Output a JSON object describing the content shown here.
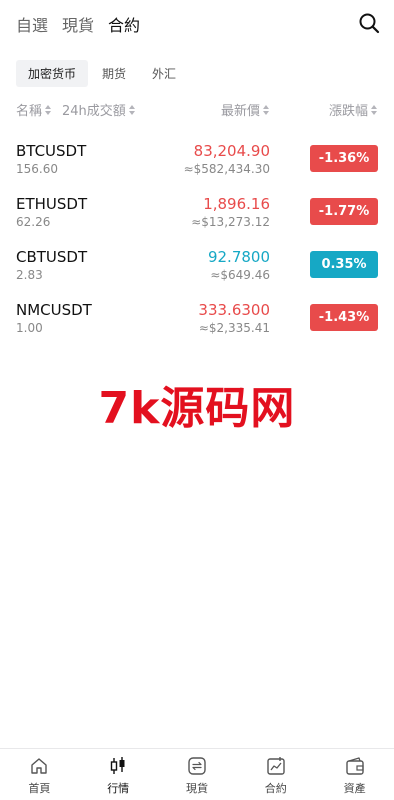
{
  "top_tabs": [
    {
      "label": "自選",
      "active": false
    },
    {
      "label": "現貨",
      "active": false
    },
    {
      "label": "合約",
      "active": true
    }
  ],
  "search_icon": "search-icon",
  "sub_tabs": [
    {
      "label": "加密货币",
      "active": true
    },
    {
      "label": "期货",
      "active": false
    },
    {
      "label": "外汇",
      "active": false
    }
  ],
  "columns": {
    "name": "名稱",
    "volume": "24h成交額",
    "price": "最新價",
    "change": "漲跌幅"
  },
  "rows": [
    {
      "symbol": "BTCUSDT",
      "volume": "156.60",
      "price": "83,204.90",
      "converted": "≈$582,434.30",
      "change": "-1.36%",
      "direction": "down"
    },
    {
      "symbol": "ETHUSDT",
      "volume": "62.26",
      "price": "1,896.16",
      "converted": "≈$13,273.12",
      "change": "-1.77%",
      "direction": "down"
    },
    {
      "symbol": "CBTUSDT",
      "volume": "2.83",
      "price": "92.7800",
      "converted": "≈$649.46",
      "change": "0.35%",
      "direction": "up"
    },
    {
      "symbol": "NMCUSDT",
      "volume": "1.00",
      "price": "333.6300",
      "converted": "≈$2,335.41",
      "change": "-1.43%",
      "direction": "down"
    }
  ],
  "colors": {
    "down": "#e84b4b",
    "up": "#16a8c5",
    "watermark": "#e3101f"
  },
  "watermark": "7k源码网",
  "bottom_nav": [
    {
      "label": "首頁",
      "icon": "home-icon",
      "active": false
    },
    {
      "label": "行情",
      "icon": "candlestick-icon",
      "active": true
    },
    {
      "label": "現貨",
      "icon": "exchange-icon",
      "active": false
    },
    {
      "label": "合約",
      "icon": "chart-card-icon",
      "active": false
    },
    {
      "label": "資產",
      "icon": "wallet-icon",
      "active": false
    }
  ]
}
